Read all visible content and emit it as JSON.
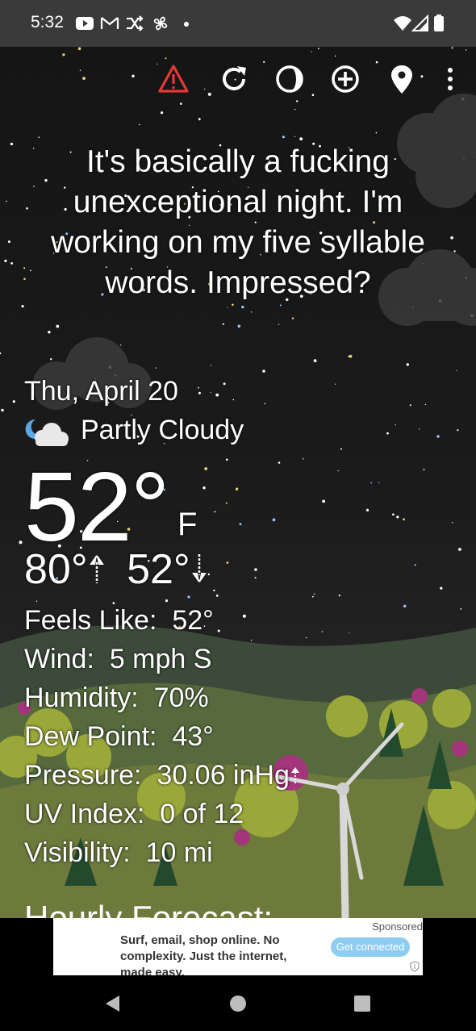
{
  "status_bar": {
    "time": "5:32",
    "left_icons": [
      "youtube-icon",
      "gmail-icon",
      "shuffle-icon",
      "fan-icon",
      "dot-icon"
    ],
    "right_icons": [
      "wifi-icon",
      "signal-icon",
      "battery-icon"
    ]
  },
  "toolbar": {
    "icons": [
      "alert-icon",
      "refresh-icon",
      "moon-phase-icon",
      "add-location-icon",
      "location-pin-icon",
      "more-vert-icon"
    ],
    "alert_color": "#e53935"
  },
  "snark_text": "It's basically a fucking unexceptional night. I'm working on my five syllable words. Impressed?",
  "current": {
    "date": "Thu, April 20",
    "condition": "Partly Cloudy",
    "condition_icon": "partly-cloudy-night-icon",
    "temperature": "52°",
    "unit": "F",
    "high": "80°",
    "low": "52°"
  },
  "details": [
    {
      "label": "Feels Like:",
      "value": "52°"
    },
    {
      "label": "Wind:",
      "value": "5 mph S"
    },
    {
      "label": "Humidity:",
      "value": "70%"
    },
    {
      "label": "Dew Point:",
      "value": "43°"
    },
    {
      "label": "Pressure:",
      "value": "30.06 inHg"
    },
    {
      "label": "UV Index:",
      "value": "0 of 12"
    },
    {
      "label": "Visibility:",
      "value": "10 mi"
    }
  ],
  "hourly_title": "Hourly Forecast:",
  "ad": {
    "sponsored": "Sponsored",
    "text": "Surf, email, shop online. No complexity. Just the internet, made easy.",
    "cta": "Get connected"
  },
  "nav": [
    "back-icon",
    "home-icon",
    "recents-icon"
  ]
}
